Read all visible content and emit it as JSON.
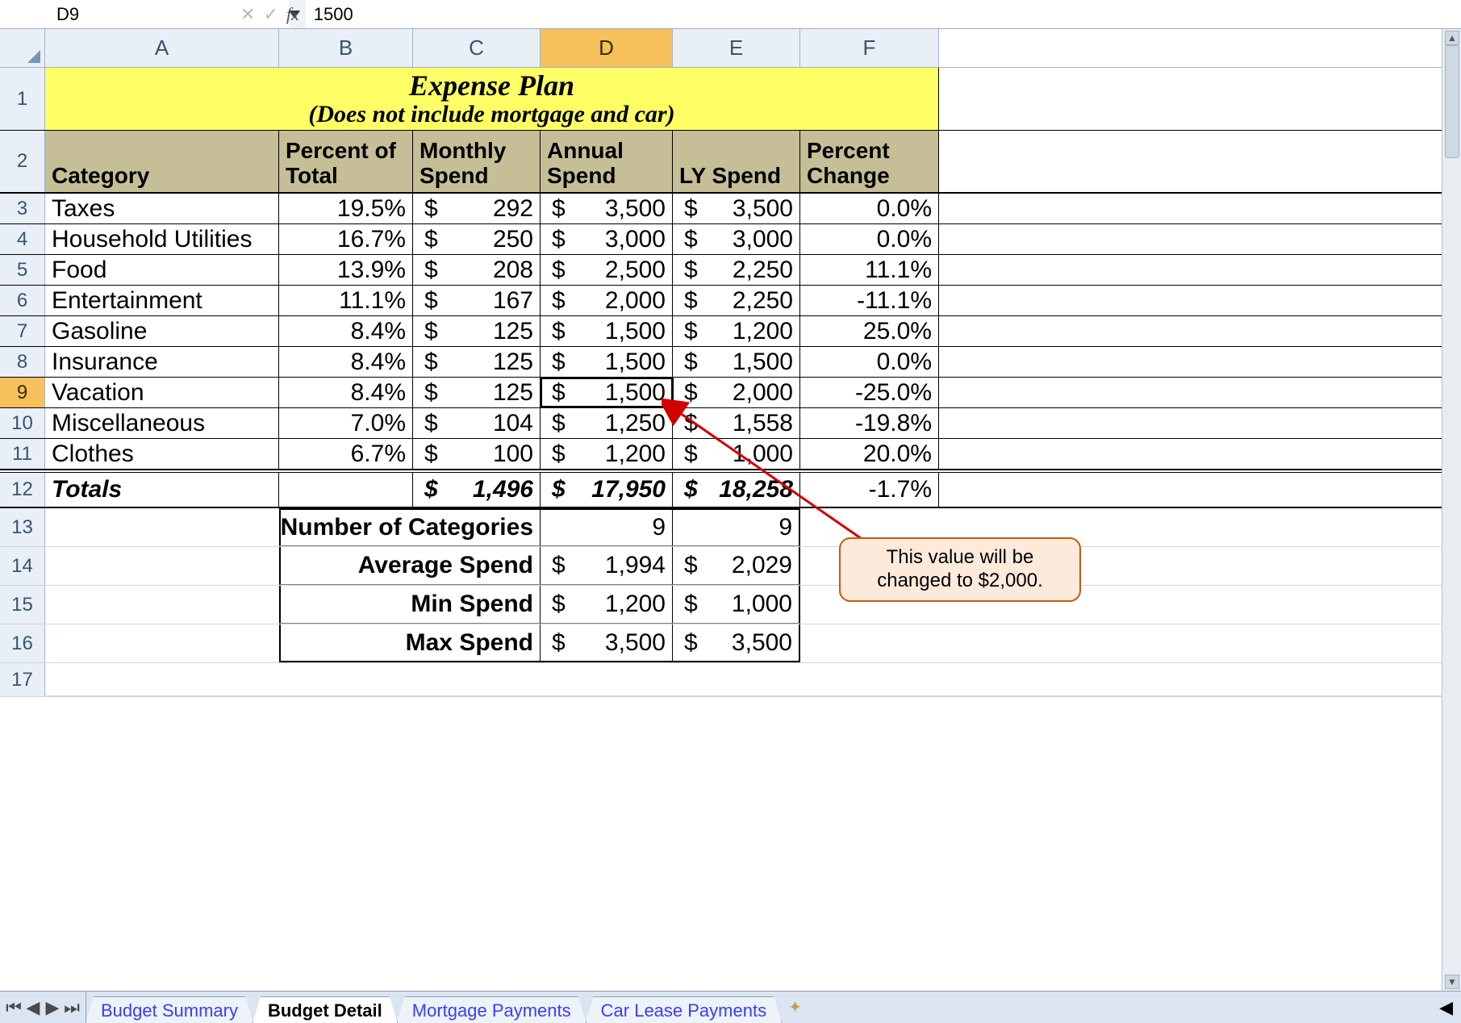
{
  "formula_bar": {
    "cell_ref": "D9",
    "fx_label": "fx",
    "formula": "1500"
  },
  "columns": [
    "A",
    "B",
    "C",
    "D",
    "E",
    "F"
  ],
  "active_col": "D",
  "active_row": "9",
  "title": {
    "line1": "Expense Plan",
    "line2": "(Does not include mortgage and car)"
  },
  "headers": {
    "category": "Category",
    "percent": "Percent of Total",
    "monthly": "Monthly Spend",
    "annual": "Annual Spend",
    "ly": "LY Spend",
    "change": "Percent Change"
  },
  "rows": [
    {
      "n": "3",
      "cat": "Taxes",
      "pct": "19.5%",
      "mon": "292",
      "ann": "3,500",
      "ly": "3,500",
      "chg": "0.0%"
    },
    {
      "n": "4",
      "cat": "Household Utilities",
      "pct": "16.7%",
      "mon": "250",
      "ann": "3,000",
      "ly": "3,000",
      "chg": "0.0%"
    },
    {
      "n": "5",
      "cat": "Food",
      "pct": "13.9%",
      "mon": "208",
      "ann": "2,500",
      "ly": "2,250",
      "chg": "11.1%"
    },
    {
      "n": "6",
      "cat": "Entertainment",
      "pct": "11.1%",
      "mon": "167",
      "ann": "2,000",
      "ly": "2,250",
      "chg": "-11.1%"
    },
    {
      "n": "7",
      "cat": "Gasoline",
      "pct": "8.4%",
      "mon": "125",
      "ann": "1,500",
      "ly": "1,200",
      "chg": "25.0%"
    },
    {
      "n": "8",
      "cat": "Insurance",
      "pct": "8.4%",
      "mon": "125",
      "ann": "1,500",
      "ly": "1,500",
      "chg": "0.0%"
    },
    {
      "n": "9",
      "cat": "Vacation",
      "pct": "8.4%",
      "mon": "125",
      "ann": "1,500",
      "ly": "2,000",
      "chg": "-25.0%"
    },
    {
      "n": "10",
      "cat": "Miscellaneous",
      "pct": "7.0%",
      "mon": "104",
      "ann": "1,250",
      "ly": "1,558",
      "chg": "-19.8%"
    },
    {
      "n": "11",
      "cat": "Clothes",
      "pct": "6.7%",
      "mon": "100",
      "ann": "1,200",
      "ly": "1,000",
      "chg": "20.0%"
    }
  ],
  "totals": {
    "n": "12",
    "label": "Totals",
    "mon": "1,496",
    "ann": "17,950",
    "ly": "18,258",
    "chg": "-1.7%"
  },
  "summary": [
    {
      "n": "13",
      "label": "Number of Categories",
      "d": "9",
      "e": "9",
      "currency": false
    },
    {
      "n": "14",
      "label": "Average Spend",
      "d": "1,994",
      "e": "2,029",
      "currency": true
    },
    {
      "n": "15",
      "label": "Min Spend",
      "d": "1,200",
      "e": "1,000",
      "currency": true
    },
    {
      "n": "16",
      "label": "Max Spend",
      "d": "3,500",
      "e": "3,500",
      "currency": true
    }
  ],
  "empty_rows": [
    "17"
  ],
  "callout": "This value will be changed to $2,000.",
  "tabs": [
    "Budget Summary",
    "Budget Detail",
    "Mortgage Payments",
    "Car Lease Payments"
  ],
  "active_tab": "Budget Detail",
  "currency_symbol": "$"
}
